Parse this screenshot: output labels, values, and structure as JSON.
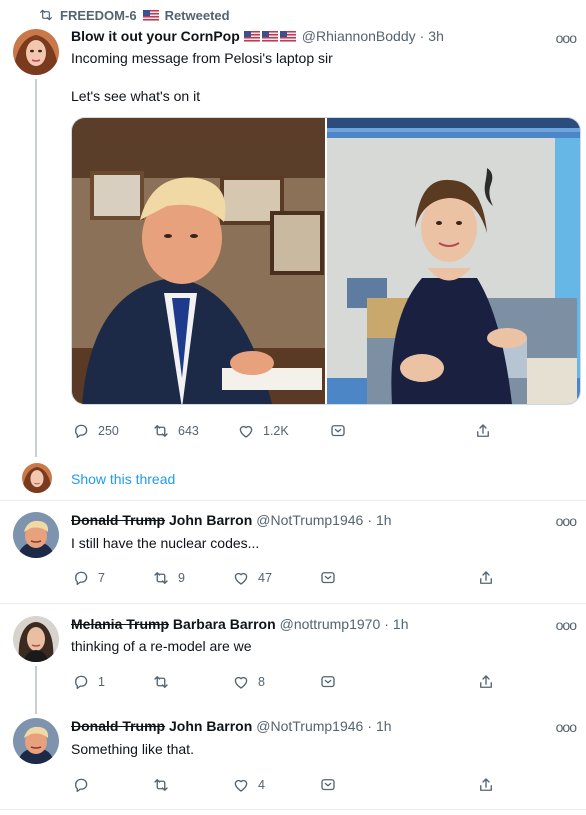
{
  "retweet": {
    "account": "FREEDOM-6",
    "label": "Retweeted"
  },
  "main_tweet": {
    "name": "Blow it out your CornPop",
    "handle": "@RhiannonBoddy",
    "time": "3h",
    "text_line1": "Incoming message from Pelosi's laptop sir",
    "text_line2": "Let's see what's on it",
    "replies": "250",
    "retweets": "643",
    "likes": "1.2K",
    "show_thread": "Show this thread"
  },
  "replies": [
    {
      "struck_name": "Donald Trump",
      "name": "John Barron",
      "handle": "@NotTrump1946",
      "time": "1h",
      "text": "I still have the nuclear codes...",
      "replies": "7",
      "retweets": "9",
      "likes": "47"
    },
    {
      "struck_name": "Melania Trump",
      "name": "Barbara Barron",
      "handle": "@nottrump1970",
      "time": "1h",
      "text": "thinking of a re-model are we",
      "replies": "1",
      "retweets": "",
      "likes": "8"
    },
    {
      "struck_name": "Donald Trump",
      "name": "John Barron",
      "handle": "@NotTrump1946",
      "time": "1h",
      "text": "Something like that.",
      "replies": "",
      "retweets": "",
      "likes": "4"
    }
  ],
  "separator": "·",
  "more_glyph": "ooo",
  "icons": {
    "retweet": "retweet-icon",
    "reply": "reply-icon",
    "like": "heart-icon",
    "bookmark": "bookmark-icon",
    "share": "share-icon",
    "flag": "us-flag-icon"
  },
  "colors": {
    "link": "#1d9bf0",
    "muted": "#536471",
    "thread_line": "#c4cfd6"
  }
}
